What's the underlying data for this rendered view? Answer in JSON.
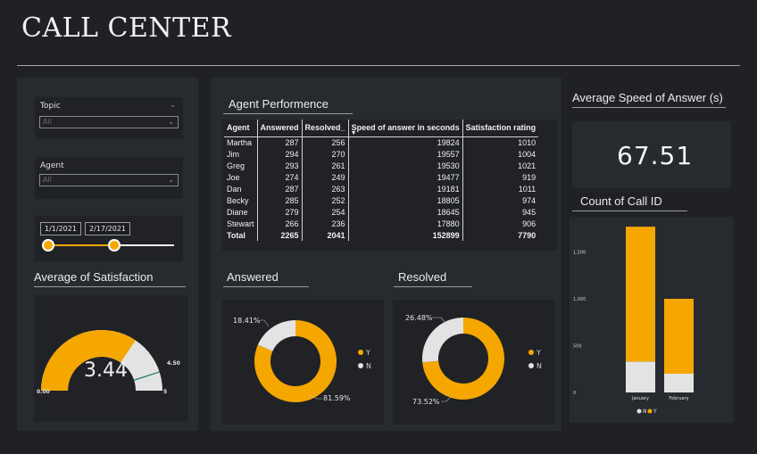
{
  "header": {
    "title": "CALL CENTER"
  },
  "filters": {
    "topic": {
      "label": "Topic",
      "value": "All"
    },
    "agent": {
      "label": "Agent",
      "value": "All"
    },
    "date": {
      "start": "1/1/2021",
      "end": "2/17/2021",
      "range_fraction": 0.53
    }
  },
  "satisfaction": {
    "title": "Average of Satisfaction",
    "value_label": "3.44",
    "value": 3.44,
    "min": 0,
    "max": 5,
    "target": 4.5,
    "min_label": "0.00",
    "max_label": "5",
    "target_label": "4.50"
  },
  "agent_performance": {
    "title": "Agent Performence",
    "columns": [
      "Agent",
      "Answered",
      "Resolved_",
      "Speed of answer in seconds",
      "Satisfaction rating"
    ],
    "rows": [
      [
        "Martha",
        "287",
        "256",
        "19824",
        "1010"
      ],
      [
        "Jim",
        "294",
        "270",
        "19557",
        "1004"
      ],
      [
        "Greg",
        "293",
        "261",
        "19530",
        "1021"
      ],
      [
        "Joe",
        "274",
        "249",
        "19477",
        "919"
      ],
      [
        "Dan",
        "287",
        "263",
        "19181",
        "1011"
      ],
      [
        "Becky",
        "285",
        "252",
        "18805",
        "974"
      ],
      [
        "Diane",
        "279",
        "254",
        "18645",
        "945"
      ],
      [
        "Stewart",
        "266",
        "236",
        "17880",
        "906"
      ]
    ],
    "total": [
      "Total",
      "2265",
      "2041",
      "152899",
      "7790"
    ]
  },
  "speed": {
    "title": "Average Speed of Answer (s)",
    "value": "67.51"
  },
  "answered": {
    "title": "Answered",
    "y_pct": 81.59,
    "n_pct": 18.41,
    "y_label": "81.59%",
    "n_label": "18.41%",
    "legend": [
      "Y",
      "N"
    ]
  },
  "resolved": {
    "title": "Resolved",
    "y_pct": 73.52,
    "n_pct": 26.48,
    "y_label": "73.52%",
    "n_label": "26.48%",
    "legend": [
      "Y",
      "N"
    ]
  },
  "colors": {
    "accent": "#f5a700",
    "secondary": "#e3e3e3",
    "panel": "#272a2f",
    "card": "#202226",
    "background": "#1f2125"
  },
  "chart_data": {
    "type": "bar",
    "title": "Count of Call ID",
    "categories": [
      "January",
      "February"
    ],
    "series": [
      {
        "name": "N",
        "values": [
          330,
          200
        ]
      },
      {
        "name": "Y",
        "values": [
          1440,
          800
        ]
      }
    ],
    "ylim": [
      0,
      1800
    ],
    "y_ticks": [
      0,
      500,
      1000,
      1500
    ],
    "y_tick_labels": [
      "0",
      "500",
      "1,000",
      "1,500"
    ],
    "legend": [
      "N",
      "Y"
    ],
    "legend_position": "bottom",
    "stacked": true
  }
}
